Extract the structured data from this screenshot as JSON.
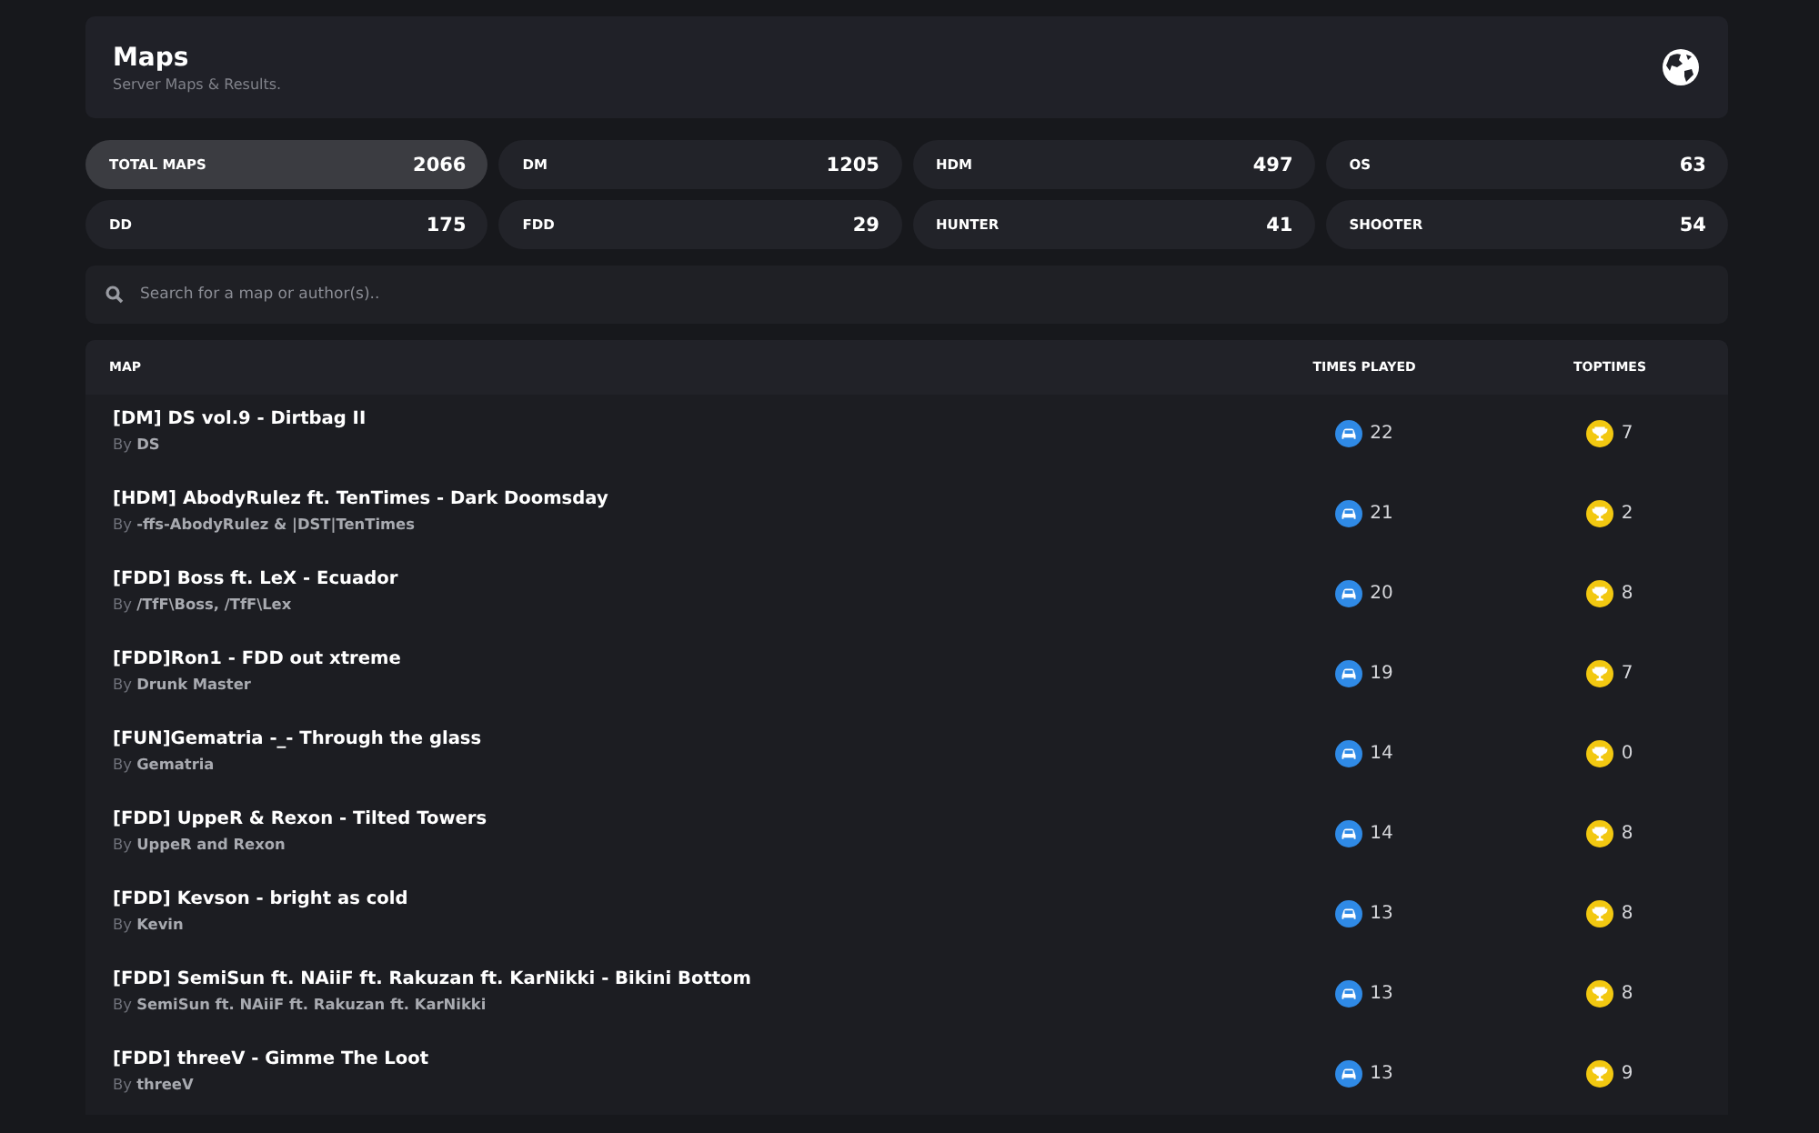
{
  "header": {
    "title": "Maps",
    "subtitle": "Server Maps & Results."
  },
  "stats": [
    {
      "label": "TOTAL MAPS",
      "value": "2066",
      "selected": true
    },
    {
      "label": "DM",
      "value": "1205",
      "selected": false
    },
    {
      "label": "HDM",
      "value": "497",
      "selected": false
    },
    {
      "label": "OS",
      "value": "63",
      "selected": false
    },
    {
      "label": "DD",
      "value": "175",
      "selected": false
    },
    {
      "label": "FDD",
      "value": "29",
      "selected": false
    },
    {
      "label": "HUNTER",
      "value": "41",
      "selected": false
    },
    {
      "label": "SHOOTER",
      "value": "54",
      "selected": false
    }
  ],
  "search": {
    "placeholder": "Search for a map or author(s).."
  },
  "table": {
    "columns": [
      "MAP",
      "TIMES PLAYED",
      "TOPTIMES"
    ],
    "rows": [
      {
        "title": "[DM] DS vol.9 - Dirtbag II",
        "author": "By **DS**",
        "played": "22",
        "toptimes": "7"
      },
      {
        "title": "[HDM] AbodyRulez ft. TenTimes - Dark Doomsday",
        "author": "By **-ffs-AbodyRulez & |DST|TenTimes**",
        "played": "21",
        "toptimes": "2"
      },
      {
        "title": "[FDD] Boss ft. LeX - Ecuador",
        "author": "By **/TfF\\Boss, /TfF\\Lex**",
        "played": "20",
        "toptimes": "8"
      },
      {
        "title": "[FDD]Ron1 - FDD out xtreme",
        "author": "By **Drunk Master**",
        "played": "19",
        "toptimes": "7"
      },
      {
        "title": "[FUN]Gematria -_- Through the glass",
        "author": "By **Gematria**",
        "played": "14",
        "toptimes": "0"
      },
      {
        "title": "[FDD] UppeR & Rexon - Tilted Towers",
        "author": "By **UppeR and Rexon**",
        "played": "14",
        "toptimes": "8"
      },
      {
        "title": "[FDD] Kevson - bright as cold",
        "author": "By **Kevin**",
        "played": "13",
        "toptimes": "8"
      },
      {
        "title": "[FDD] SemiSun ft. NAiiF ft. Rakuzan ft. KarNikki - Bikini Bottom",
        "author": "By **SemiSun ft. NAiiF ft. Rakuzan ft. KarNikki**",
        "played": "13",
        "toptimes": "8"
      },
      {
        "title": "[FDD] threeV - Gimme The Loot",
        "author": "By **threeV**",
        "played": "13",
        "toptimes": "9"
      }
    ]
  }
}
